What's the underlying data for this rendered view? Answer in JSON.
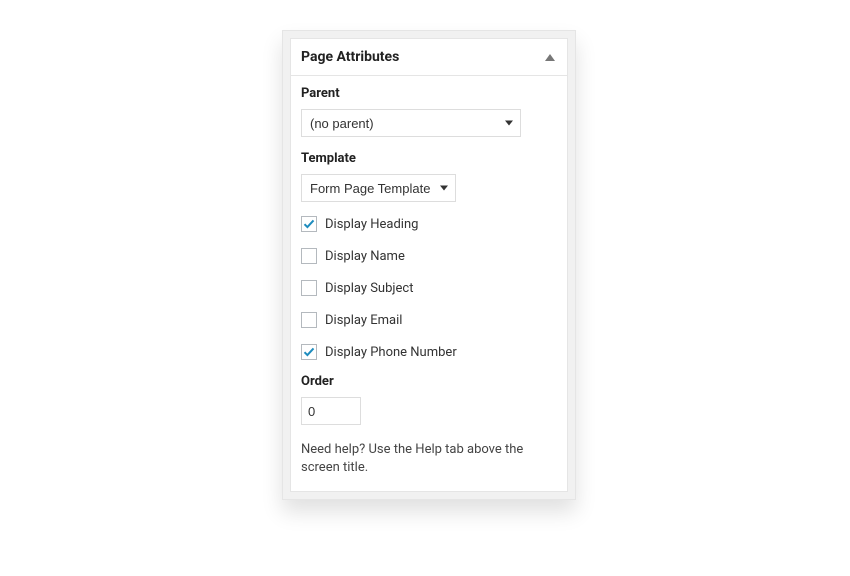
{
  "panel": {
    "title": "Page Attributes"
  },
  "parent": {
    "label": "Parent",
    "value": "(no parent)"
  },
  "template": {
    "label": "Template",
    "value": "Form Page Template"
  },
  "checkboxes": [
    {
      "label": "Display Heading",
      "checked": true
    },
    {
      "label": "Display Name",
      "checked": false
    },
    {
      "label": "Display Subject",
      "checked": false
    },
    {
      "label": "Display Email",
      "checked": false
    },
    {
      "label": "Display Phone Number",
      "checked": true
    }
  ],
  "order": {
    "label": "Order",
    "value": "0"
  },
  "help_text": "Need help? Use the Help tab above the screen title."
}
